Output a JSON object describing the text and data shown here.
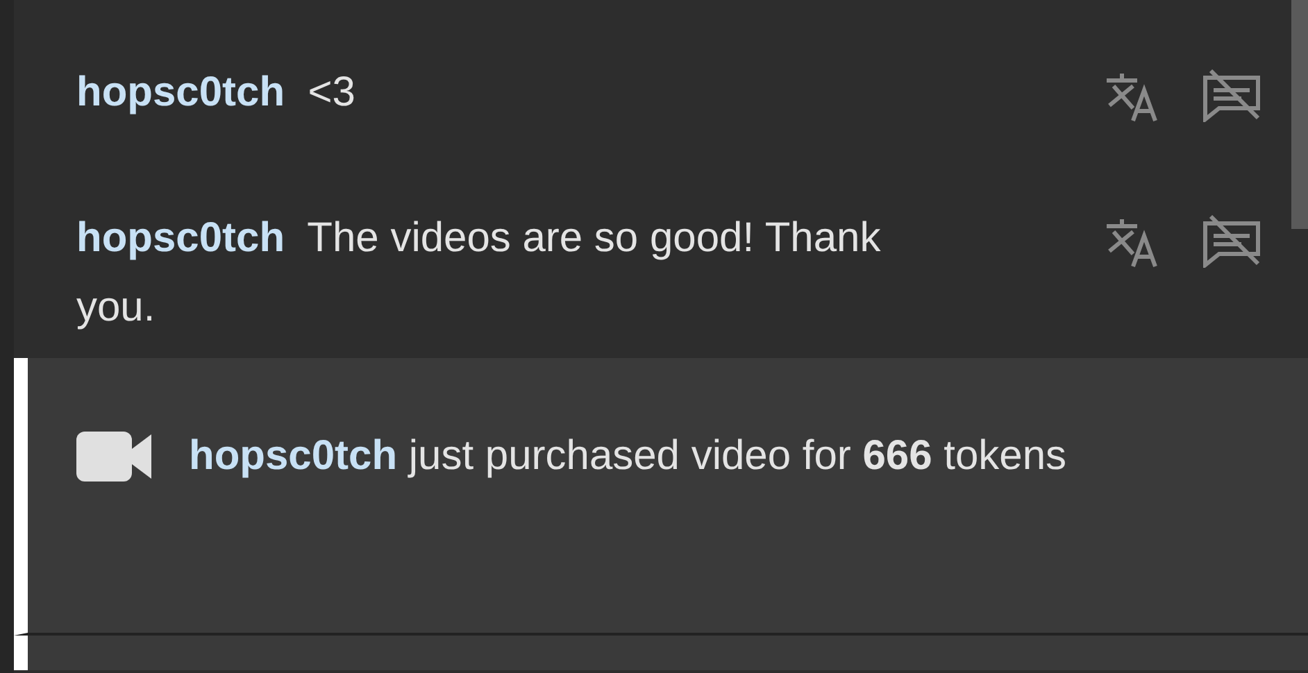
{
  "messages": [
    {
      "username": "hopsc0tch",
      "text": "<3"
    },
    {
      "username": "hopsc0tch",
      "text": "The videos are so good! Thank you."
    }
  ],
  "notice": {
    "username": "hopsc0tch",
    "text": "just purchased video for **666** tokens"
  }
}
